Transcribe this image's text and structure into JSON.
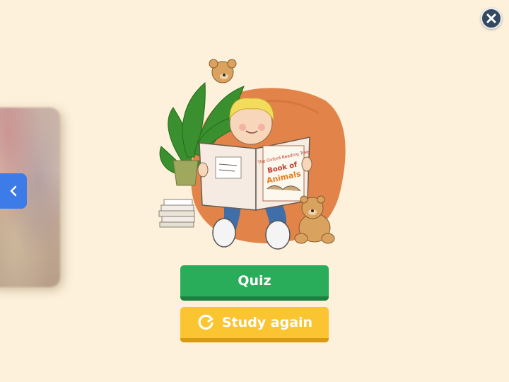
{
  "window": {
    "close_icon": "close-icon",
    "accent_close": "#34495e"
  },
  "navigation": {
    "prev_icon": "chevron-left-icon",
    "prev_color": "#3d7be8"
  },
  "illustration": {
    "book_title_small": "The Oxford Reading Tree",
    "book_title_line1": "Book of",
    "book_title_line2": "Animals"
  },
  "actions": {
    "quiz_label": "Quiz",
    "quiz_color": "#2aad5a",
    "study_again_label": "Study again",
    "study_again_icon": "refresh-icon",
    "study_again_color": "#fbc531"
  }
}
